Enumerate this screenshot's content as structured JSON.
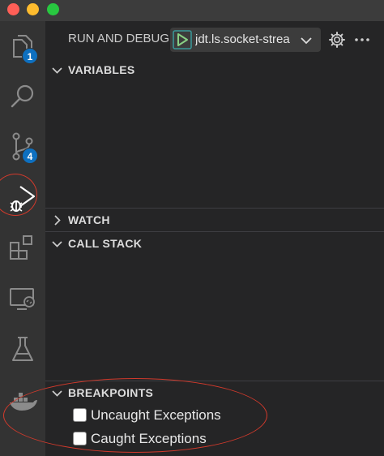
{
  "window": {
    "traffic_lights": [
      {
        "name": "close",
        "color": "#ff5f57"
      },
      {
        "name": "minimize",
        "color": "#febc2e"
      },
      {
        "name": "zoom",
        "color": "#28c840"
      }
    ]
  },
  "activity_bar": {
    "items": [
      {
        "icon": "explorer-icon",
        "badge": "1"
      },
      {
        "icon": "search-icon",
        "badge": ""
      },
      {
        "icon": "source-control-icon",
        "badge": "4"
      },
      {
        "icon": "run-and-debug-icon",
        "badge": "",
        "active": true
      },
      {
        "icon": "extensions-icon",
        "badge": ""
      },
      {
        "icon": "remote-explorer-icon",
        "badge": ""
      },
      {
        "icon": "testing-icon",
        "badge": ""
      },
      {
        "icon": "docker-icon",
        "badge": ""
      }
    ]
  },
  "sidebar": {
    "title": "RUN AND DEBUG",
    "configuration": "jdt.ls.socket-strea",
    "sections": {
      "variables": "VARIABLES",
      "watch": "WATCH",
      "call_stack": "CALL STACK",
      "breakpoints": "BREAKPOINTS"
    },
    "breakpoints": [
      {
        "label": "Uncaught Exceptions",
        "checked": false
      },
      {
        "label": "Caught Exceptions",
        "checked": false
      }
    ]
  },
  "colors": {
    "accent_badge": "#0e70c0",
    "debug_start_green": "#89d185",
    "annotation_red": "#d33a2c"
  }
}
